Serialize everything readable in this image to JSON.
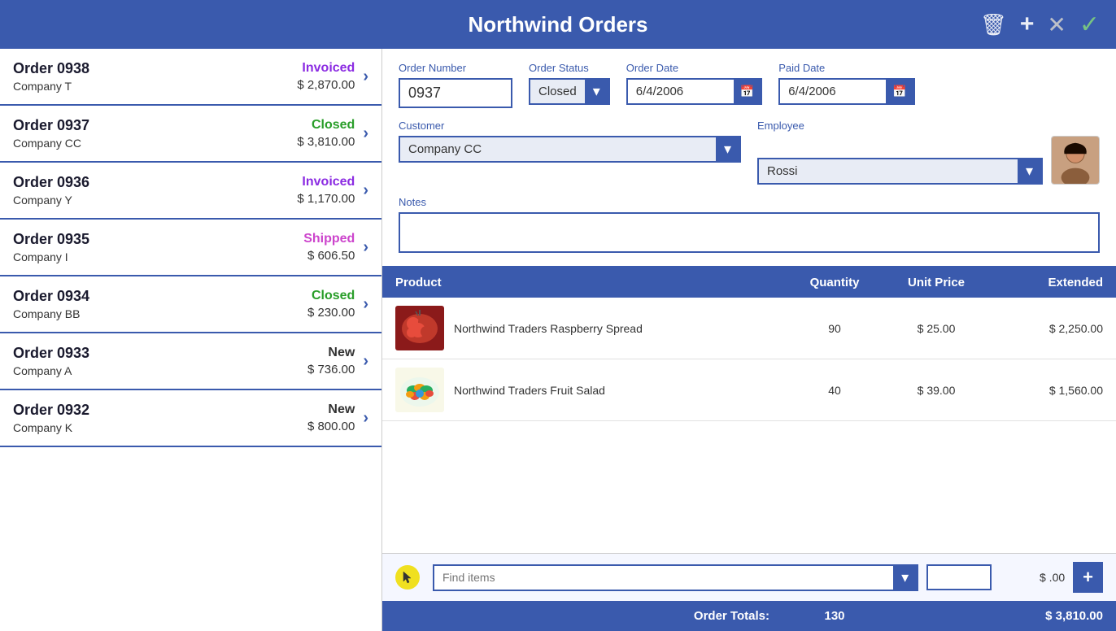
{
  "header": {
    "title": "Northwind Orders",
    "delete_label": "🗑",
    "add_label": "+",
    "cancel_label": "✕",
    "confirm_label": "✓"
  },
  "orders": [
    {
      "id": "order-0938",
      "number": "Order 0938",
      "company": "Company T",
      "status": "Invoiced",
      "status_class": "status-invoiced",
      "amount": "$ 2,870.00"
    },
    {
      "id": "order-0937",
      "number": "Order 0937",
      "company": "Company CC",
      "status": "Closed",
      "status_class": "status-closed",
      "amount": "$ 3,810.00"
    },
    {
      "id": "order-0936",
      "number": "Order 0936",
      "company": "Company Y",
      "status": "Invoiced",
      "status_class": "status-invoiced",
      "amount": "$ 1,170.00"
    },
    {
      "id": "order-0935",
      "number": "Order 0935",
      "company": "Company I",
      "status": "Shipped",
      "status_class": "status-shipped",
      "amount": "$ 606.50"
    },
    {
      "id": "order-0934",
      "number": "Order 0934",
      "company": "Company BB",
      "status": "Closed",
      "status_class": "status-closed",
      "amount": "$ 230.00"
    },
    {
      "id": "order-0933",
      "number": "Order 0933",
      "company": "Company A",
      "status": "New",
      "status_class": "status-new",
      "amount": "$ 736.00"
    },
    {
      "id": "order-0932",
      "number": "Order 0932",
      "company": "Company K",
      "status": "New",
      "status_class": "status-new",
      "amount": "$ 800.00"
    }
  ],
  "detail": {
    "order_number_label": "Order Number",
    "order_number_value": "0937",
    "order_status_label": "Order Status",
    "order_status_value": "Closed",
    "order_date_label": "Order Date",
    "order_date_value": "6/4/2006",
    "paid_date_label": "Paid Date",
    "paid_date_value": "6/4/2006",
    "customer_label": "Customer",
    "customer_value": "Company CC",
    "employee_label": "Employee",
    "employee_value": "Rossi",
    "notes_label": "Notes",
    "notes_value": "",
    "table": {
      "col_product": "Product",
      "col_quantity": "Quantity",
      "col_unit_price": "Unit Price",
      "col_extended": "Extended"
    },
    "products": [
      {
        "name": "Northwind Traders Raspberry Spread",
        "quantity": "90",
        "unit_price": "$ 25.00",
        "extended": "$ 2,250.00",
        "img_type": "raspberry"
      },
      {
        "name": "Northwind Traders Fruit Salad",
        "quantity": "40",
        "unit_price": "$ 39.00",
        "extended": "$ 1,560.00",
        "img_type": "fruit-salad"
      }
    ],
    "find_items_placeholder": "Find items",
    "add_price": "$ .00",
    "totals_label": "Order Totals:",
    "total_quantity": "130",
    "total_amount": "$ 3,810.00"
  }
}
